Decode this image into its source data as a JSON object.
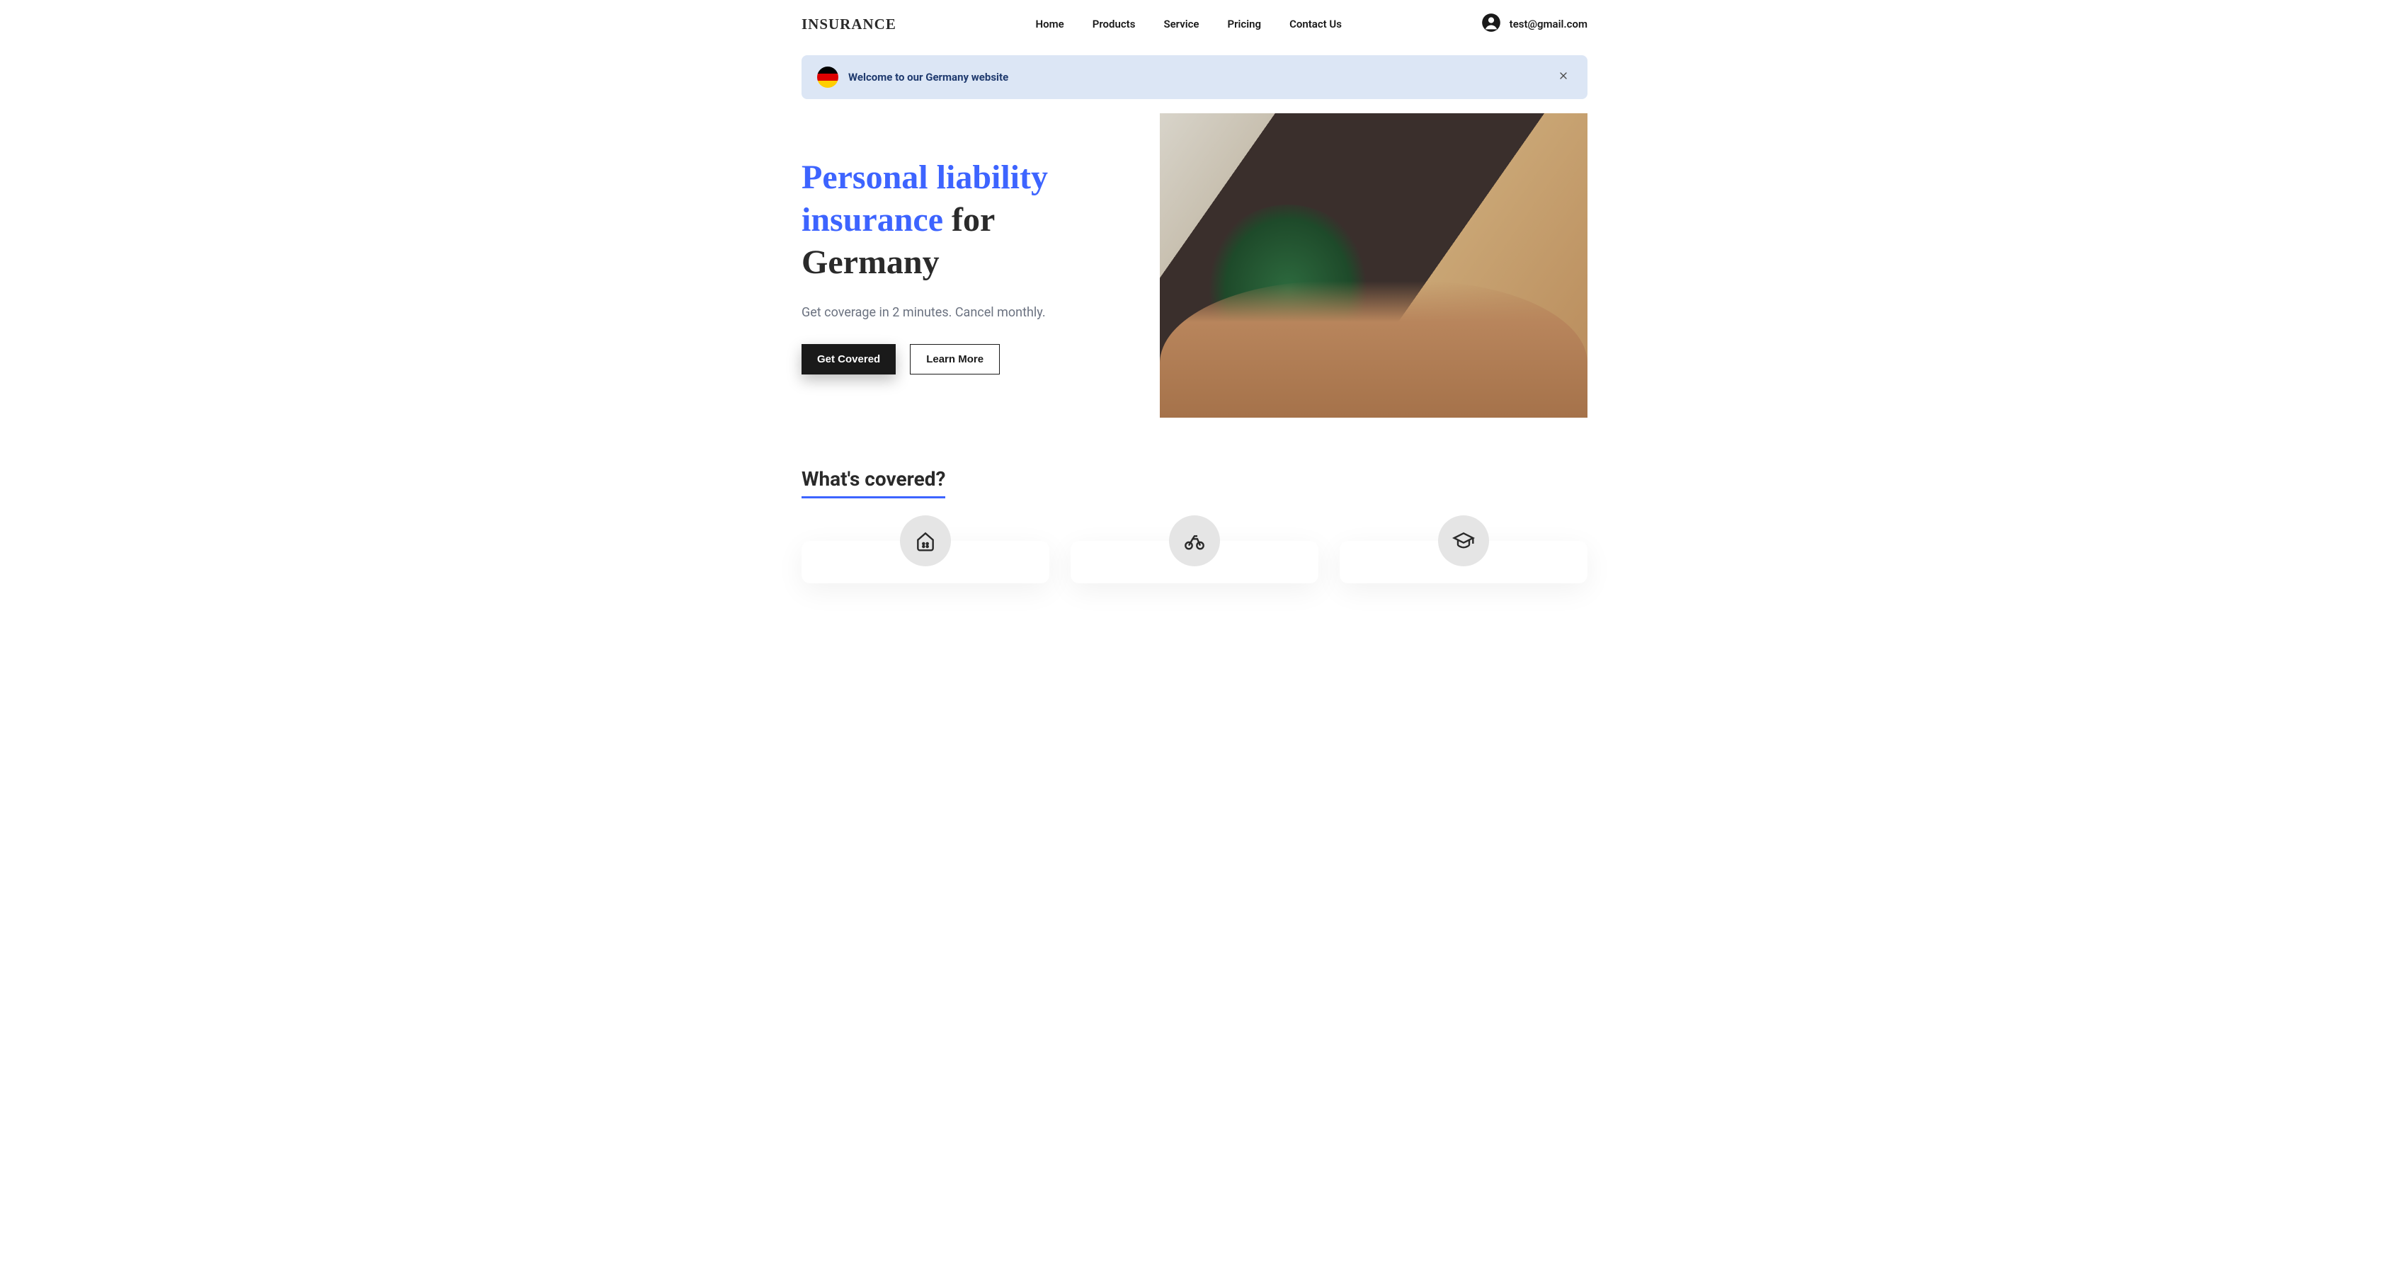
{
  "brand": "INSURANCE",
  "nav": {
    "items": [
      {
        "label": "Home"
      },
      {
        "label": "Products"
      },
      {
        "label": "Service"
      },
      {
        "label": "Pricing"
      },
      {
        "label": "Contact Us"
      }
    ]
  },
  "account": {
    "email": "test@gmail.com"
  },
  "banner": {
    "message": "Welcome to our Germany website"
  },
  "hero": {
    "title_highlight": "Personal liability insurance",
    "title_rest": " for Germany",
    "subtitle": "Get coverage in 2 minutes. Cancel monthly.",
    "cta_primary": "Get Covered",
    "cta_secondary": "Learn More"
  },
  "section": {
    "covered_title": "What's covered?"
  }
}
